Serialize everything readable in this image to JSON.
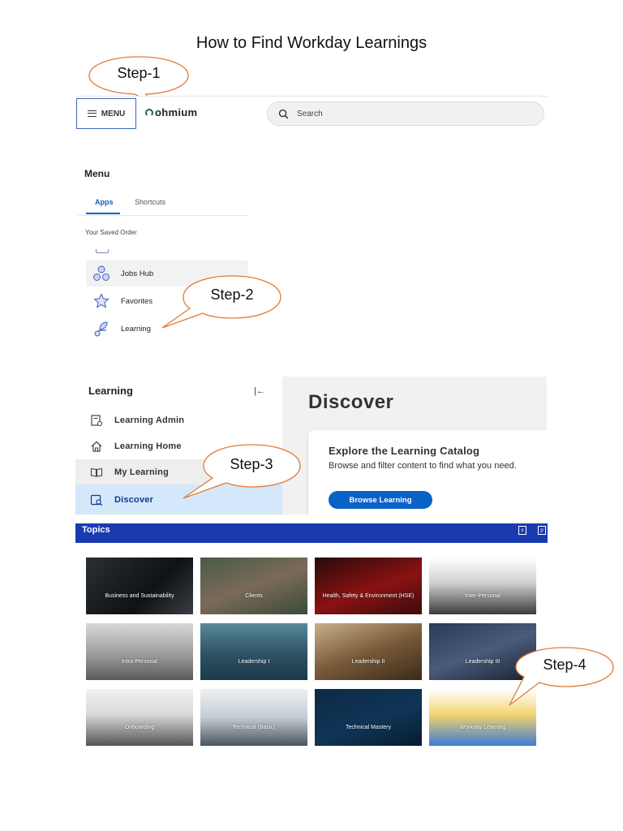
{
  "document": {
    "title": "How to Find Workday Learnings"
  },
  "callouts": {
    "step1": "Step-1",
    "step2": "Step-2",
    "step3": "Step-3",
    "step4": "Step-4"
  },
  "header": {
    "menu_label": "MENU",
    "brand": "ohmium",
    "search_placeholder": "Search"
  },
  "menu_panel": {
    "title": "Menu",
    "tabs": [
      {
        "label": "Apps",
        "active": true
      },
      {
        "label": "Shortcuts",
        "active": false
      }
    ],
    "section": "Your Saved Order",
    "items": [
      {
        "label": "Jobs Hub",
        "icon": "jobs-hub-icon"
      },
      {
        "label": "Favorites",
        "icon": "star-icon"
      },
      {
        "label": "Learning",
        "icon": "learning-icon"
      }
    ]
  },
  "learning_panel": {
    "title": "Learning",
    "items": [
      {
        "label": "Learning Admin",
        "icon": "admin-icon"
      },
      {
        "label": "Learning Home",
        "icon": "home-icon"
      },
      {
        "label": "My Learning",
        "icon": "book-icon"
      },
      {
        "label": "Discover",
        "icon": "discover-icon",
        "selected": true
      }
    ]
  },
  "discover": {
    "title": "Discover",
    "card_title": "Explore the Learning Catalog",
    "card_desc": "Browse and filter content to find what you need.",
    "button": "Browse Learning"
  },
  "topics": {
    "title": "Topics",
    "tiles": [
      "Business and Sustainability",
      "Clients",
      "Health, Safety & Environment (HSE)",
      "Inter-Personal",
      "Intra-Personal",
      "Leadership I",
      "Leadership II",
      "Leadership III",
      "Onboarding",
      "Technical (Basic)",
      "Technical Mastery",
      "Workday Learning"
    ]
  },
  "colors": {
    "accent": "#0a62c7",
    "topics_bar": "#1a3bb0",
    "callout_stroke": "#e07b39"
  }
}
